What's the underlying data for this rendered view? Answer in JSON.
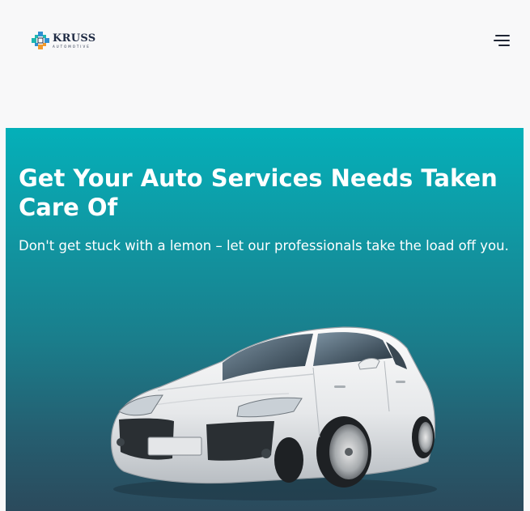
{
  "header": {
    "logo_name": "KRUSS",
    "logo_subtitle": "AUTOMOTIVE",
    "menu_icon": "hamburger-menu-icon"
  },
  "hero": {
    "title": "Get Your Auto Services Needs Taken Care Of",
    "subtitle": "Don't get stuck with a lemon – let our professionals take the load off you.",
    "image": "white-sedan-car"
  },
  "colors": {
    "hero_gradient_top": "#04b0b9",
    "hero_gradient_bottom": "#2b4a5c",
    "brand_dark": "#1f2b44",
    "logo_blue": "#2f8fd1",
    "logo_teal": "#1fb6b0",
    "logo_orange": "#f29a2e",
    "page_background": "#f8f8f9"
  }
}
